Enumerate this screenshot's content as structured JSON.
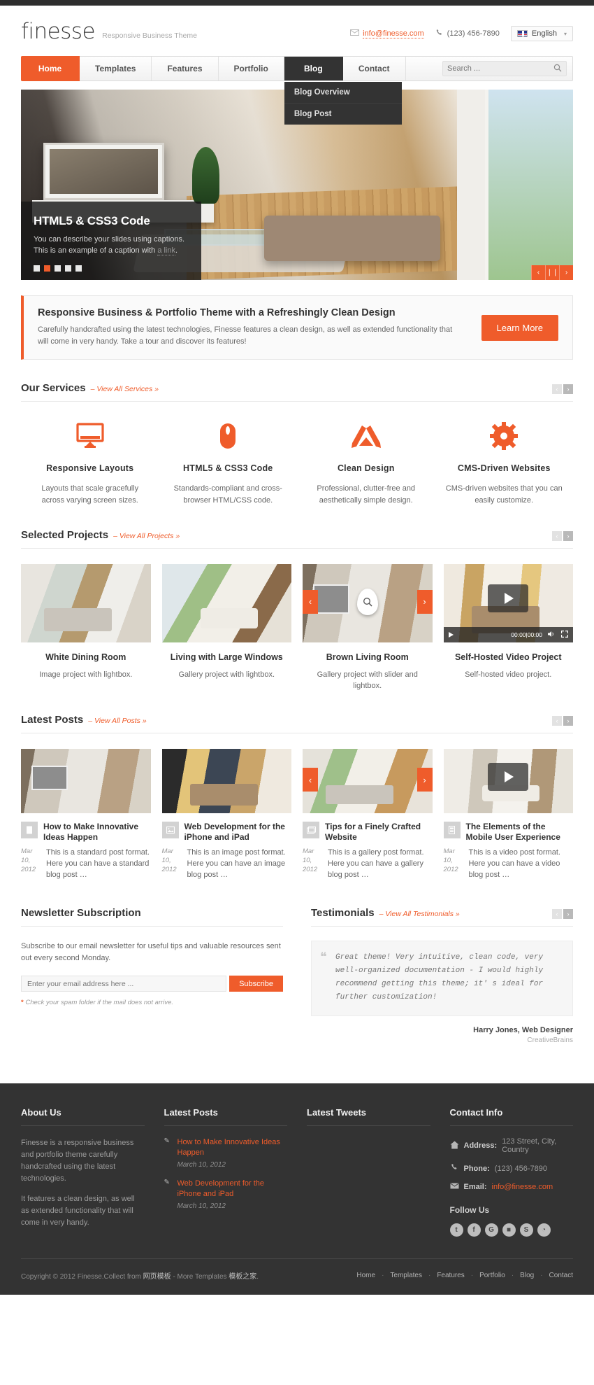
{
  "header": {
    "logo": "finesse",
    "tagline": "Responsive Business Theme",
    "email": "info@finesse.com",
    "phone": "(123) 456-7890",
    "language": "English",
    "email_icon": "envelope-icon",
    "phone_icon": "phone-icon",
    "flag_icon": "uk-flag-icon"
  },
  "nav": {
    "items": [
      {
        "label": "Home",
        "state": "active"
      },
      {
        "label": "Templates",
        "state": "default"
      },
      {
        "label": "Features",
        "state": "default"
      },
      {
        "label": "Portfolio",
        "state": "default"
      },
      {
        "label": "Blog",
        "state": "open"
      },
      {
        "label": "Contact",
        "state": "default"
      }
    ],
    "dropdown": [
      "Blog Overview",
      "Blog Post"
    ],
    "search_placeholder": "Search ...",
    "search_value": "",
    "search_icon": "search-icon"
  },
  "slider": {
    "title": "HTML5 & CSS3 Code",
    "caption_pre": "You can describe your slides using captions. This is an example of a caption with ",
    "caption_link": "a link",
    "caption_post": ".",
    "bullets": 5,
    "active_bullet": 2,
    "prev": "‹",
    "pause": "❘❘",
    "next": "›"
  },
  "promo": {
    "title": "Responsive Business & Portfolio Theme with a Refreshingly Clean Design",
    "body": "Carefully handcrafted using the latest technologies, Finesse features a clean design, as well as extended functionality that will come in very handy. Take a tour and discover its features!",
    "button": "Learn More"
  },
  "services": {
    "heading": "Our Services",
    "more": "– View All Services »",
    "prev": "‹",
    "next": "›",
    "items": [
      {
        "icon": "monitor-icon",
        "title": "Responsive Layouts",
        "text": "Layouts that scale gracefully across varying screen sizes."
      },
      {
        "icon": "mouse-icon",
        "title": "HTML5 & CSS3 Code",
        "text": "Standards-compliant and cross-browser HTML/CSS code."
      },
      {
        "icon": "pencil-ruler-icon",
        "title": "Clean Design",
        "text": "Professional, clutter-free and aesthetically simple design."
      },
      {
        "icon": "gear-icon",
        "title": "CMS-Driven Websites",
        "text": "CMS-driven websites that you can easily customize."
      }
    ]
  },
  "projects": {
    "heading": "Selected Projects",
    "more": "– View All Projects »",
    "prev": "‹",
    "next": "›",
    "items": [
      {
        "title": "White Dining Room",
        "text": "Image project with lightbox."
      },
      {
        "title": "Living with Large Windows",
        "text": "Gallery project with lightbox."
      },
      {
        "title": "Brown Living Room",
        "text": "Gallery project with slider and lightbox."
      },
      {
        "title": "Self-Hosted Video Project",
        "text": "Self-hosted video project."
      }
    ],
    "video_time": "00:00|00:00"
  },
  "posts": {
    "heading": "Latest Posts",
    "more": "– View All Posts »",
    "prev": "‹",
    "next": "›",
    "items": [
      {
        "format": "standard-post-icon",
        "title": "How to Make Innovative Ideas Happen",
        "date": "Mar 10, 2012",
        "excerpt": "This is a standard post format. Here you can have a standard blog post …"
      },
      {
        "format": "image-post-icon",
        "title": "Web Development for the iPhone and iPad",
        "date": "Mar 10, 2012",
        "excerpt": "This is an image post format. Here you can have an image blog post …"
      },
      {
        "format": "gallery-post-icon",
        "title": "Tips for a Finely Crafted Website",
        "date": "Mar 10, 2012",
        "excerpt": "This is a gallery post format. Here you can have a gallery blog post …"
      },
      {
        "format": "video-post-icon",
        "title": "The Elements of the Mobile User Experience",
        "date": "Mar 10, 2012",
        "excerpt": "This is a video post format. Here you can have a video blog post …"
      }
    ]
  },
  "newsletter": {
    "heading": "Newsletter Subscription",
    "description": "Subscribe to our email newsletter for useful tips and valuable resources sent out every second Monday.",
    "placeholder": "Enter your email address here ...",
    "value": "",
    "button": "Subscribe",
    "note_star": "*",
    "note": " Check your spam folder if the mail does not arrive."
  },
  "testimonials": {
    "heading": "Testimonials",
    "more": "– View All Testimonials »",
    "prev": "‹",
    "next": "›",
    "quote": "Great theme! Very intuitive, clean code, very well-organized documentation - I would highly recommend getting this theme; it' s ideal for further customization!",
    "author": "Harry Jones, Web Designer",
    "company": "CreativeBrains"
  },
  "footer": {
    "about": {
      "heading": "About Us",
      "p1": "Finesse is a responsive business and portfolio theme carefully handcrafted using the latest technologies.",
      "p2": "It features a clean design, as well as extended functionality that will come in very handy."
    },
    "latest_posts": {
      "heading": "Latest Posts",
      "items": [
        {
          "title": "How to Make Innovative Ideas Happen",
          "date": "March 10, 2012"
        },
        {
          "title": "Web Development for the iPhone and iPad",
          "date": "March 10, 2012"
        }
      ]
    },
    "tweets": {
      "heading": "Latest Tweets"
    },
    "contact": {
      "heading": "Contact Info",
      "address_label": "Address:",
      "address": " 123 Street, City, Country",
      "phone_label": "Phone:",
      "phone": " (123) 456-7890",
      "email_label": "Email:",
      "email": "info@finesse.com",
      "follow_heading": "Follow Us",
      "socials": [
        "t",
        "f",
        "G",
        "■",
        "S",
        "◔"
      ]
    },
    "copyright_pre": "Copyright © 2012 Finesse.Collect from ",
    "copyright_cn1": "网页模板",
    "copyright_mid": " - More Templates ",
    "copyright_cn2": "模板之家",
    "copyright_end": ".",
    "links": [
      "Home",
      "Templates",
      "Features",
      "Portfolio",
      "Blog",
      "Contact"
    ]
  },
  "colors": {
    "accent": "#ef5c2b",
    "dark": "#333333",
    "footer_bg": "#333333"
  }
}
